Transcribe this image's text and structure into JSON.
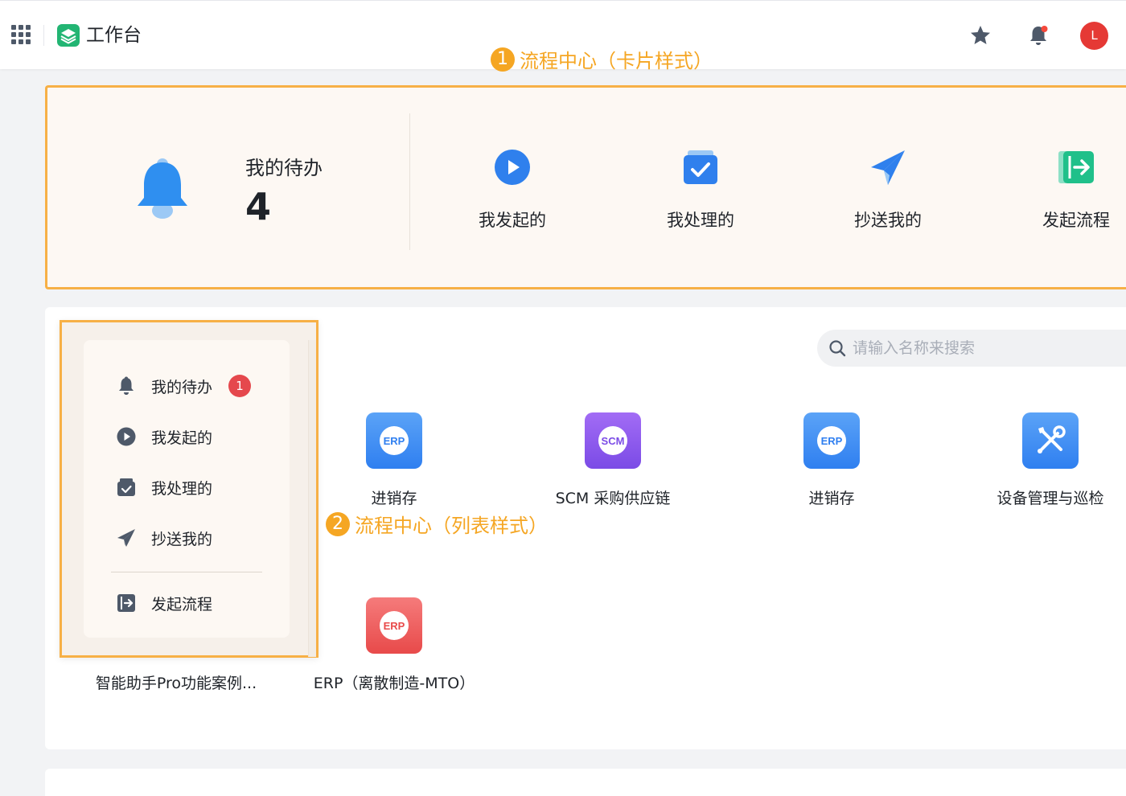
{
  "header": {
    "title": "工作台",
    "avatar_letter": "L"
  },
  "annotations": {
    "card_num": "1",
    "card_text": "流程中心（卡片样式）",
    "list_num": "2",
    "list_text": "流程中心（列表样式）"
  },
  "card": {
    "todo_label": "我的待办",
    "todo_count": "4",
    "actions": [
      {
        "label": "我发起的",
        "icon": "play-circle-icon"
      },
      {
        "label": "我处理的",
        "icon": "check-tray-icon"
      },
      {
        "label": "抄送我的",
        "icon": "paper-plane-icon"
      },
      {
        "label": "发起流程",
        "icon": "exit-arrow-icon"
      }
    ]
  },
  "list": {
    "items": [
      {
        "label": "我的待办",
        "icon": "bell-icon",
        "badge": "1"
      },
      {
        "label": "我发起的",
        "icon": "play-circle-icon"
      },
      {
        "label": "我处理的",
        "icon": "check-tray-icon"
      },
      {
        "label": "抄送我的",
        "icon": "paper-plane-icon"
      },
      {
        "label": "发起流程",
        "icon": "exit-arrow-icon"
      }
    ]
  },
  "search": {
    "placeholder": "请输入名称来搜索"
  },
  "apps": [
    {
      "label": "进销存",
      "badge_text": "ERP",
      "color": "#3b82f6"
    },
    {
      "label": "SCM 采购供应链",
      "badge_text": "SCM",
      "color": "#8b5cf6"
    },
    {
      "label": "进销存",
      "badge_text": "ERP",
      "color": "#3b82f6"
    },
    {
      "label": "设备管理与巡检",
      "icon": "tools-icon",
      "color": "#3b82f6"
    },
    {
      "label": "ERP（离散制造-MTO）",
      "badge_text": "ERP",
      "color": "#ef5350"
    },
    {
      "label": "智能助手Pro功能案例..."
    }
  ],
  "colors": {
    "accent_orange": "#f5a623",
    "primary_blue": "#2f80ed",
    "badge_red": "#e5484d"
  }
}
